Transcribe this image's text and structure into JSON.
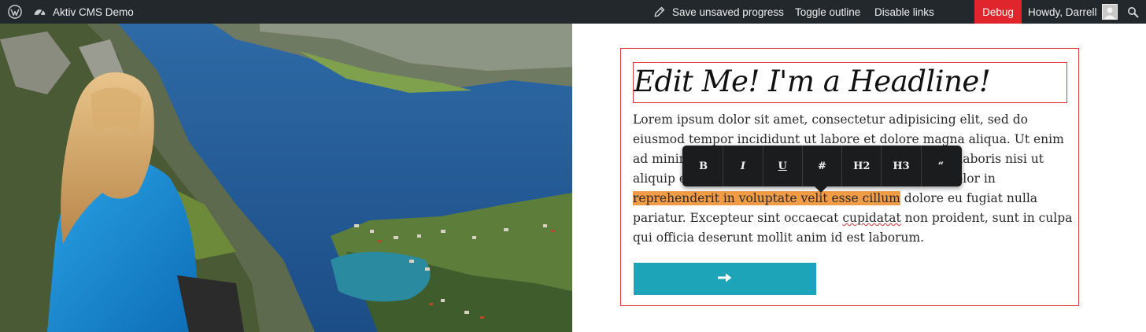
{
  "adminbar": {
    "site_name": "Aktiv CMS Demo",
    "save_label": "Save unsaved progress",
    "toggle_label": "Toggle outline",
    "disable_links_label": "Disable links",
    "debug_label": "Debug",
    "greeting": "Howdy, Darrell",
    "icons": [
      "wordpress-logo-icon",
      "dashboard-gauge-icon",
      "pencil-icon",
      "search-icon"
    ],
    "colors": {
      "bar": "#23282d",
      "debug": "#e0262c"
    }
  },
  "content": {
    "headline": "Edit Me! I'm a Headline!",
    "paragraph": {
      "seg1": "Lorem ipsum dolor sit amet, consectetur adipisicing elit, sed do eiusmod tempor incididunt ut labore et dolore magna aliqua. Ut enim ad minim veniam, quis nostrud exercitation ullamco laboris nisi ut aliquip ex ea commodo consequat. Duis aute irure dolor in ",
      "highlight": "reprehenderit in voluptate velit esse cillum",
      "seg2": " dolore eu fugiat nulla pariatur. Excepteur sint occaecat ",
      "misspelled": "cupidatat",
      "seg3": " non proident, sunt in culpa qui officia deserunt mollit anim id est laborum."
    },
    "cta_icon": "arrow-right-icon",
    "colors": {
      "outline": "#e0373d",
      "highlight": "#f09b45",
      "cta": "#1ea4b9"
    }
  },
  "toolbar": {
    "buttons": [
      {
        "label": "B"
      },
      {
        "label": "I"
      },
      {
        "label": "U"
      },
      {
        "label": "#"
      },
      {
        "label": "H2"
      },
      {
        "label": "H3"
      },
      {
        "label": "“"
      }
    ]
  }
}
